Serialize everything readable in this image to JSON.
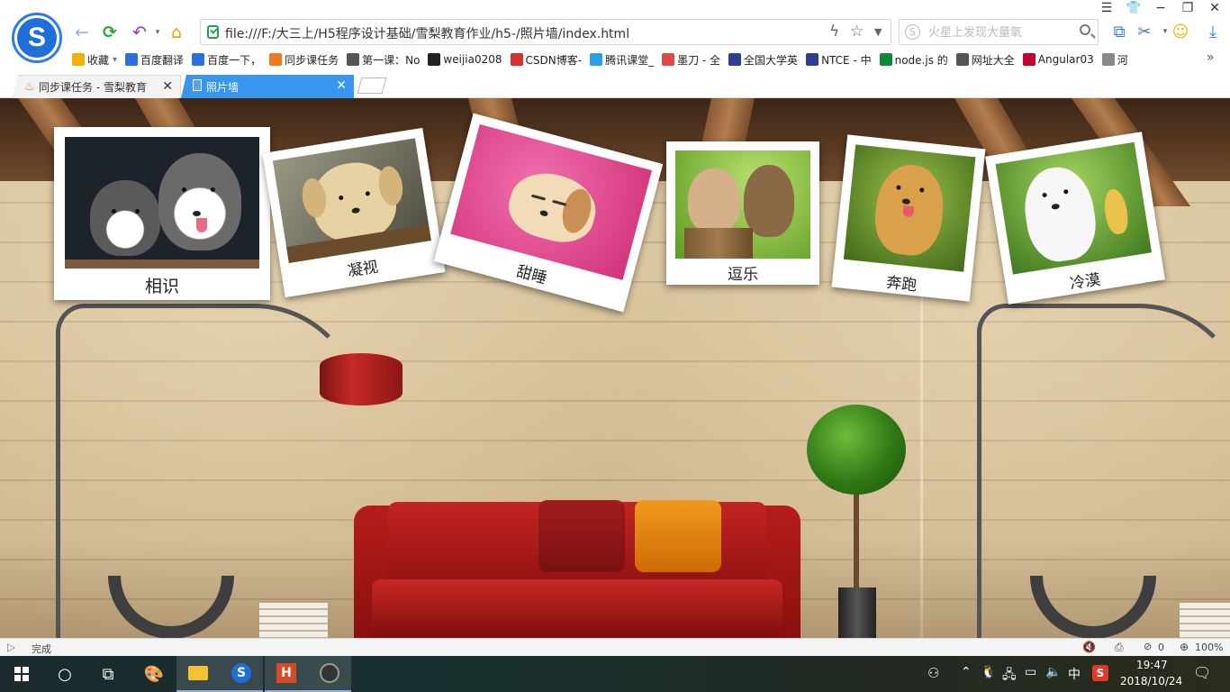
{
  "browser": {
    "address_url": "file:///F:/大三上/H5程序设计基础/雪梨教育作业/h5-/照片墙/index.html",
    "search_placeholder": "火星上发现大量氧"
  },
  "bookmarks": [
    {
      "label": "收藏",
      "icon": "star-icon",
      "color": "#f0b400"
    },
    {
      "label": "百度翻译",
      "icon": "translate-icon",
      "color": "#2d6fe0"
    },
    {
      "label": "百度一下，",
      "icon": "baidu-paw-icon",
      "color": "#2d6fe0"
    },
    {
      "label": "同步课任务",
      "icon": "flame-icon",
      "color": "#f07a1e"
    },
    {
      "label": "第一课：No",
      "icon": "book-icon",
      "color": "#555555"
    },
    {
      "label": "weijia0208",
      "icon": "github-icon",
      "color": "#222222"
    },
    {
      "label": "CSDN博客-",
      "icon": "csdn-icon",
      "color": "#d6312e"
    },
    {
      "label": "腾讯课堂_",
      "icon": "tencent-class-icon",
      "color": "#2aa0e8"
    },
    {
      "label": "墨刀 - 全",
      "icon": "modao-icon",
      "color": "#e04848"
    },
    {
      "label": "全国大学英",
      "icon": "globe-badge-icon",
      "color": "#2f3f8f"
    },
    {
      "label": "NTCE - 中",
      "icon": "ntce-icon",
      "color": "#2f3f8f"
    },
    {
      "label": "node.js 的",
      "icon": "sf-icon",
      "color": "#0b8b3a"
    },
    {
      "label": "网址大全",
      "icon": "globe-icon",
      "color": "#555555"
    },
    {
      "label": "Angular03",
      "icon": "angular-icon",
      "color": "#c3002f"
    },
    {
      "label": "河",
      "icon": "page-icon",
      "color": "#888888"
    }
  ],
  "tabs": [
    {
      "label": "同步课任务 - 雪梨教育",
      "active": false
    },
    {
      "label": "照片墙",
      "active": true
    }
  ],
  "photos": [
    {
      "caption": "相识",
      "subject": "two husky puppies",
      "fur": "#c9c9c9",
      "bg": "#1c232b"
    },
    {
      "caption": "凝视",
      "subject": "labrador puppy in basket",
      "fur": "#e7d2a4",
      "bg": "#6a6b5a"
    },
    {
      "caption": "甜睡",
      "subject": "sleeping puppy on pink blanket",
      "fur": "#f2dcb7",
      "bg": "#e0488e"
    },
    {
      "caption": "逗乐",
      "subject": "two puppies kissing",
      "fur": "#c89a66",
      "bg": "#8dc63f"
    },
    {
      "caption": "奔跑",
      "subject": "running shiba puppy",
      "fur": "#d9a24a",
      "bg": "#6c8a2c"
    },
    {
      "caption": "冷漠",
      "subject": "white puppy with duckling",
      "fur": "#f4f4f4",
      "bg": "#5a9a2a"
    }
  ],
  "statusbar": {
    "status_text": "完成",
    "counter": "0",
    "zoom": "100%"
  },
  "taskbar": {
    "time": "19:47",
    "date": "2018/10/24",
    "ime": "中"
  }
}
